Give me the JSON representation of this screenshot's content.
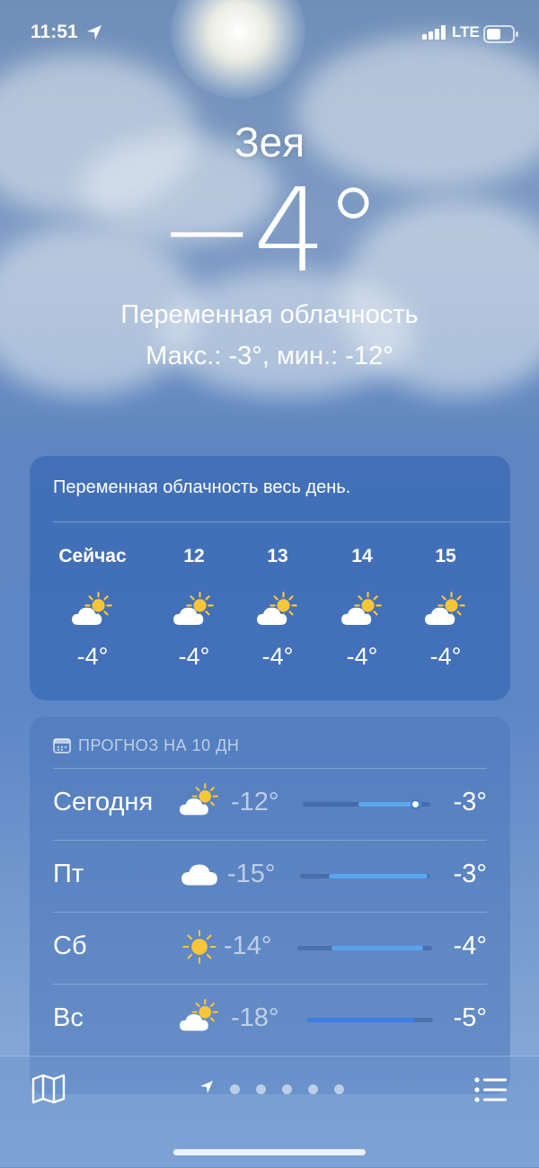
{
  "status_bar": {
    "time": "11:51",
    "network": "LTE"
  },
  "current": {
    "city": "Зея",
    "temperature": "−4°",
    "condition": "Переменная облачность",
    "hi_lo": "Макс.: -3°, мин.: -12°"
  },
  "hourly": {
    "summary": "Переменная облачность весь день.",
    "items": [
      {
        "time": "Сейчас",
        "icon": "partly-cloudy-icon",
        "temp": "-4°"
      },
      {
        "time": "12",
        "icon": "partly-cloudy-icon",
        "temp": "-4°"
      },
      {
        "time": "13",
        "icon": "partly-cloudy-icon",
        "temp": "-4°"
      },
      {
        "time": "14",
        "icon": "partly-cloudy-icon",
        "temp": "-4°"
      },
      {
        "time": "15",
        "icon": "partly-cloudy-icon",
        "temp": "-4°"
      }
    ]
  },
  "daily": {
    "header": "ПРОГНОЗ НА 10 ДН",
    "days": [
      {
        "day": "Сегодня",
        "icon": "partly-cloudy-icon",
        "low": "-12°",
        "high": "-3°",
        "range_start": 0.44,
        "range_end": 0.93,
        "current": 0.88,
        "color": "#5ba9f0"
      },
      {
        "day": "Пт",
        "icon": "cloud-icon",
        "low": "-15°",
        "high": "-3°",
        "range_start": 0.22,
        "range_end": 0.98,
        "color": "#5aa6f0"
      },
      {
        "day": "Сб",
        "icon": "sun-icon",
        "low": "-14°",
        "high": "-4°",
        "range_start": 0.25,
        "range_end": 0.93,
        "color": "#5aa2ee"
      },
      {
        "day": "Вс",
        "icon": "partly-cloudy-icon",
        "low": "-18°",
        "high": "-5°",
        "range_start": 0.0,
        "range_end": 0.85,
        "color": "#3d7ee6"
      }
    ]
  },
  "toolbar": {
    "pages": 5,
    "active_page": 0
  },
  "colors": {
    "sun": "#f7c637",
    "cloud": "#ffffff"
  }
}
